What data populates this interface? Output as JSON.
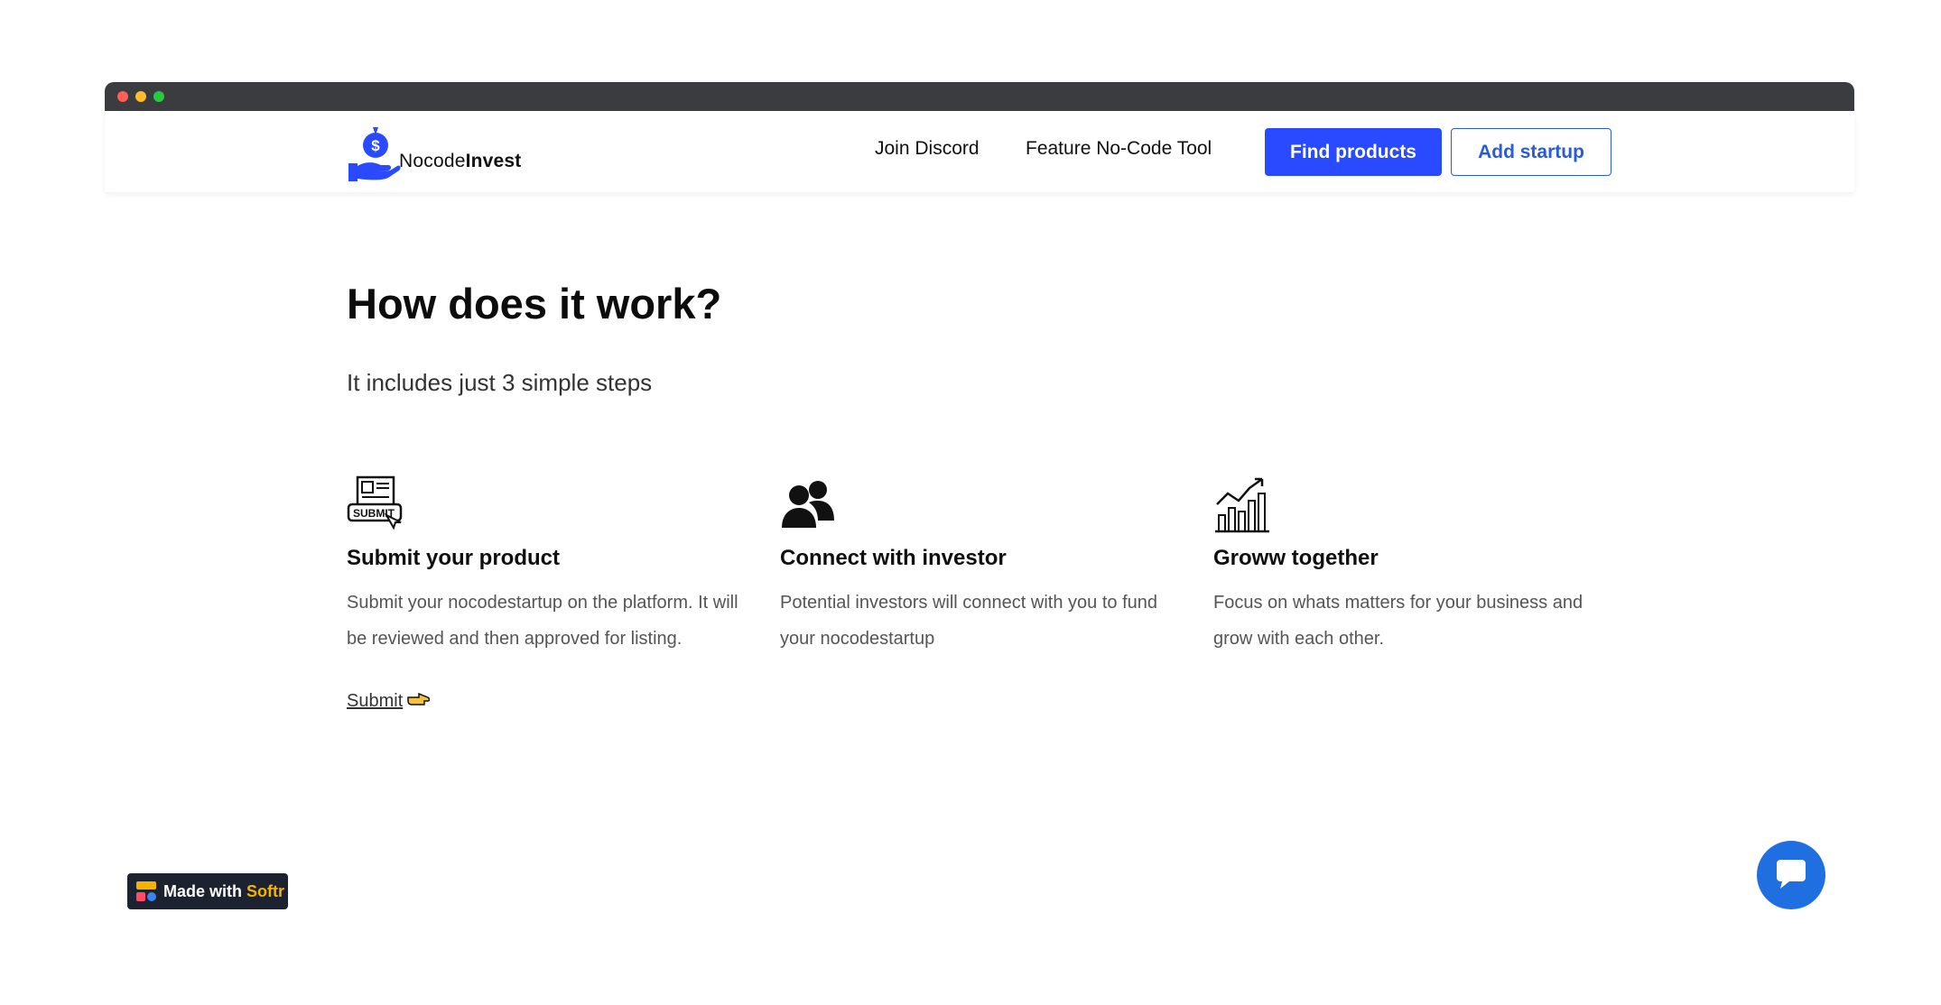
{
  "brand": {
    "name_regular": "Nocode",
    "name_bold": "Invest",
    "accent_color": "#2a4aff"
  },
  "nav": {
    "links": [
      {
        "label": "Join Discord"
      },
      {
        "label": "Feature No-Code Tool"
      }
    ],
    "find_products_label": "Find products",
    "add_startup_label": "Add startup"
  },
  "main": {
    "title": "How does it work?",
    "subtitle": "It includes just 3 simple steps",
    "steps": [
      {
        "icon": "submit-form-icon",
        "title": "Submit your product",
        "description": "Submit your nocodestartup on the platform. It will be reviewed and then approved for listing.",
        "link_label": "Submit",
        "link_icon": "pointing-hand-icon"
      },
      {
        "icon": "users-icon",
        "title": "Connect with investor",
        "description": "Potential investors will connect with you to fund your nocodestartup"
      },
      {
        "icon": "growth-chart-icon",
        "title": "Groww together",
        "description": "Focus on whats matters for your business and grow with each other."
      }
    ]
  },
  "footer_badge": {
    "prefix": "Made with",
    "brand": "Softr",
    "brand_color": "#f5b300"
  },
  "chat": {
    "icon": "chat-bubble-icon",
    "color": "#1f6fe0"
  }
}
